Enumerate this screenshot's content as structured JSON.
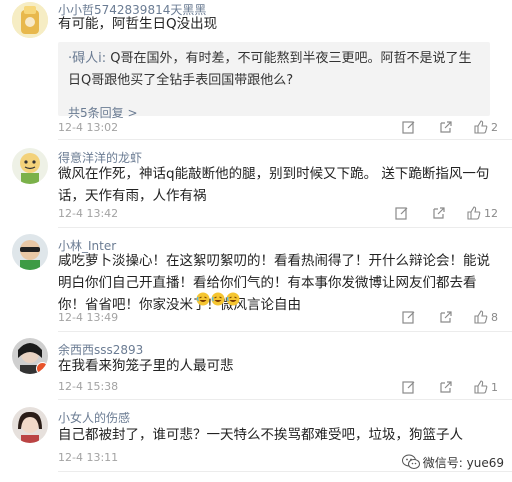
{
  "comments": [
    {
      "username": "小小哲5742839814天黑黑",
      "text": "有可能，阿哲生日Q没出现",
      "reply": {
        "user": "·碍人i:",
        "text": " Q哥在国外，有时差，不可能熬到半夜三更吧。阿哲不是说了生日Q哥跟他买了全钻手表回国带跟他么?",
        "more": "共5条回复 >"
      },
      "time": "12-4 13:02",
      "likes": "2"
    },
    {
      "username": "得意洋洋的龙虾",
      "text": "微风在作死，神话q能敲断他的腿，别到时候又下跪。 送下跪断指风一句话，天作有雨，人作有祸",
      "time": "12-4 13:42",
      "likes": "12"
    },
    {
      "username": "小林_Inter",
      "text": "咸吃萝卜淡操心！在这絮叨絮叨的！看看热闹得了！开什么辩论会！能说明白你们自己开直播！看给你们气的！有本事你发微博让网友们都去看你！省省吧！你家没米了！微风言论自由",
      "time": "12-4 13:49",
      "likes": "8"
    },
    {
      "username": "余西西sss2893",
      "text": "在我看来狗笼子里的人最可悲",
      "time": "12-4 15:38",
      "likes": "1"
    },
    {
      "username": "小女人的伤感",
      "text": "自己都被封了，谁可悲？一天特么不挨骂都难受吧，垃圾，狗篮子人",
      "time": "12-4 13:11"
    }
  ],
  "watermark": "微信号: yue69",
  "icons": [
    "edit-icon",
    "share-icon",
    "like-icon",
    "laugh-emoji",
    "wechat-icon"
  ],
  "colors": {
    "username": "#6b7c93",
    "time": "#a3a3a3",
    "replybox": "#f3f3f3"
  }
}
